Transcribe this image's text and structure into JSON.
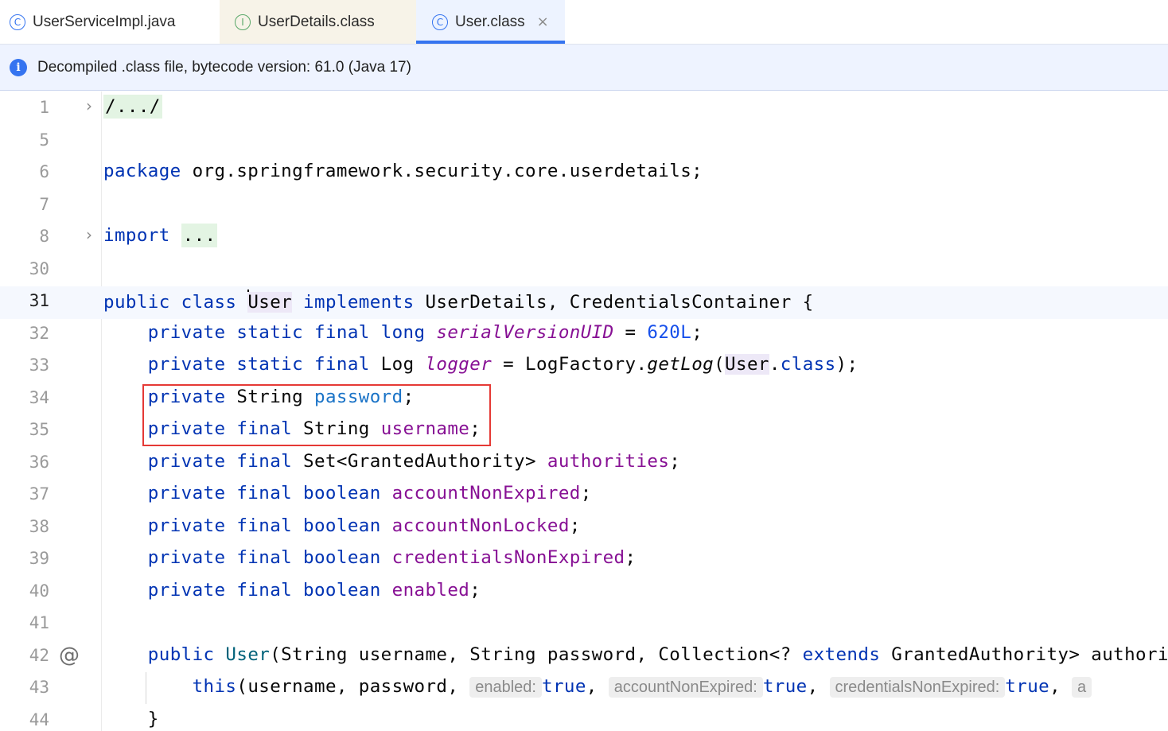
{
  "tabs": [
    {
      "icon": "C",
      "label": "UserServiceImpl.java"
    },
    {
      "icon": "I",
      "label": "UserDetails.class"
    },
    {
      "icon": "C",
      "label": "User.class",
      "close": "×"
    }
  ],
  "banner": {
    "text": "Decompiled .class file, bytecode version: 61.0 (Java 17)"
  },
  "lines": {
    "n1": "1",
    "n5": "5",
    "n6": "6",
    "n7": "7",
    "n8": "8",
    "n30": "30",
    "n31": "31",
    "n32": "32",
    "n33": "33",
    "n34": "34",
    "n35": "35",
    "n36": "36",
    "n37": "37",
    "n38": "38",
    "n39": "39",
    "n40": "40",
    "n41": "41",
    "n42": "42",
    "n43": "43",
    "n44": "44"
  },
  "code": {
    "l1_fold": "/.../",
    "l6_kw": "package",
    "l6_pkg": " org.springframework.security.core.userdetails;",
    "l8_kw": "import",
    "l8_fold": "...",
    "l31_a": "public class ",
    "l31_cls": "User",
    "l31_b": " implements",
    "l31_c": " UserDetails, CredentialsContainer {",
    "l32_kw": "private static final long ",
    "l32_f": "serialVersionUID",
    "l32_eq": " = ",
    "l32_n": "620L",
    "l32_end": ";",
    "l33_kw": "private static final",
    "l33_t": " Log ",
    "l33_f": "logger",
    "l33_m": " = LogFactory.",
    "l33_call": "getLog",
    "l33_p": "(",
    "l33_u": "User",
    "l33_dot": ".",
    "l33_cls": "class",
    "l33_end": ");",
    "l34_kw": "private",
    "l34_t": " String ",
    "l34_f": "password",
    "l34_end": ";",
    "l35_kw": "private final",
    "l35_t": " String ",
    "l35_f": "username",
    "l35_end": ";",
    "l36_kw": "private final",
    "l36_t": " Set<GrantedAuthority> ",
    "l36_f": "authorities",
    "l36_end": ";",
    "l37_kw": "private final boolean ",
    "l37_f": "accountNonExpired",
    "l37_end": ";",
    "l38_kw": "private final boolean ",
    "l38_f": "accountNonLocked",
    "l38_end": ";",
    "l39_kw": "private final boolean ",
    "l39_f": "credentialsNonExpired",
    "l39_end": ";",
    "l40_kw": "private final boolean ",
    "l40_f": "enabled",
    "l40_end": ";",
    "l42_kw": "public",
    "l42_fn": " User",
    "l42_a": "(String username, String password, Collection<? ",
    "l42_ext": "extends",
    "l42_b": " GrantedAuthority> authori",
    "l43_kw": "this",
    "l43_a": "(username, password, ",
    "l43_h1": "enabled:",
    "l43_v1": "true",
    "l43_sep1": ", ",
    "l43_h2": "accountNonExpired:",
    "l43_v2": "true",
    "l43_sep2": ", ",
    "l43_h3": "credentialsNonExpired:",
    "l43_v3": "true",
    "l43_sep3": ", ",
    "l43_h4": "a",
    "l44": "}"
  },
  "gutter": {
    "override_icon": "@"
  },
  "colors": {
    "keyword": "#0033b3",
    "field": "#871094",
    "highlight_box": "#e53935",
    "active_tab": "#3574f0"
  }
}
